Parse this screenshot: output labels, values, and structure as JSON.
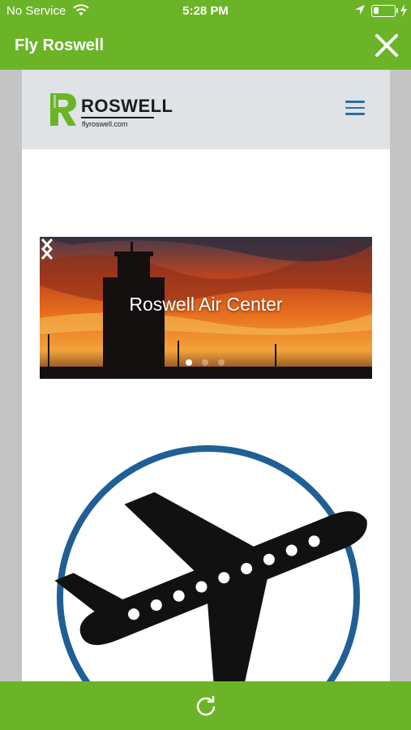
{
  "status_bar": {
    "carrier": "No Service",
    "time": "5:28 PM",
    "battery_level": 0.28
  },
  "app_header": {
    "title": "Fly Roswell",
    "close_icon": "close-icon"
  },
  "site": {
    "logo": {
      "name": "ROSWELL",
      "url": "flyroswell.com"
    },
    "menu_icon": "hamburger-menu-icon",
    "slider": {
      "caption": "Roswell Air Center",
      "slide_count": 3,
      "active_slide": 1,
      "prev_icon": "chevron-left-icon",
      "next_icon": "chevron-right-icon"
    },
    "feature_icon": "airplane-icon"
  },
  "bottom_bar": {
    "refresh_icon": "refresh-icon"
  },
  "colors": {
    "brand_green": "#6cb427",
    "accent_blue": "#1f5f96",
    "header_gray": "#dfe3e6"
  }
}
